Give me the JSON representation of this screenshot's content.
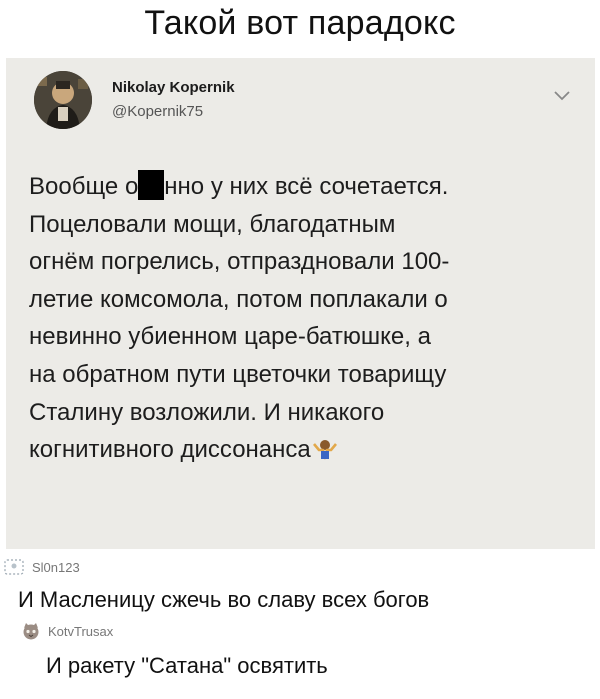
{
  "title": "Такой вот парадокс",
  "tweet": {
    "name": "Nikolay Kopernik",
    "handle": "@Kopernik75",
    "text_before_redaction": "Вообще о",
    "text_after_redaction": "нно у них всё сочетается.",
    "lines": [
      "Поцеловали мощи, благодатным",
      "огнём погрелись, отпраздновали 100-",
      "летие комсомола, потом поплакали о",
      "невинно убиенном царе-батюшке, а",
      "на обратном пути цветочки товарищу",
      "Сталину возложили. И никакого",
      "когнитивного диссонанса"
    ],
    "avatar_icon": "avatar-photo",
    "menu_icon": "chevron-down-icon",
    "end_emoji": "shrug-emoji"
  },
  "comments": [
    {
      "username": "Sl0n123",
      "text": "И Масленицу сжечь во славу всех богов",
      "avatar_icon": "default-avatar-icon"
    },
    {
      "username": "KotvTrusax",
      "text": "И ракету \"Сатана\" освятить",
      "avatar_icon": "cat-avatar-icon"
    }
  ]
}
